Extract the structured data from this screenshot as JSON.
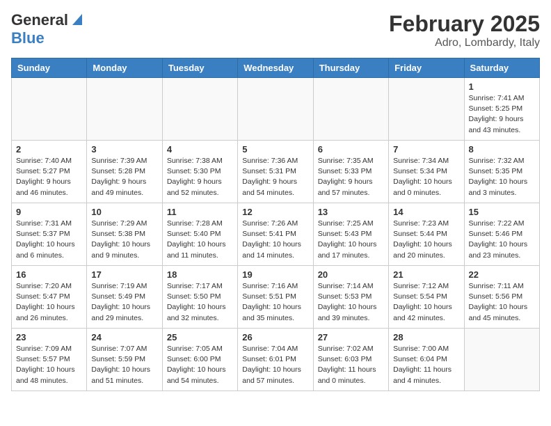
{
  "header": {
    "logo_general": "General",
    "logo_blue": "Blue",
    "title": "February 2025",
    "subtitle": "Adro, Lombardy, Italy"
  },
  "weekdays": [
    "Sunday",
    "Monday",
    "Tuesday",
    "Wednesday",
    "Thursday",
    "Friday",
    "Saturday"
  ],
  "weeks": [
    [
      {
        "day": "",
        "detail": ""
      },
      {
        "day": "",
        "detail": ""
      },
      {
        "day": "",
        "detail": ""
      },
      {
        "day": "",
        "detail": ""
      },
      {
        "day": "",
        "detail": ""
      },
      {
        "day": "",
        "detail": ""
      },
      {
        "day": "1",
        "detail": "Sunrise: 7:41 AM\nSunset: 5:25 PM\nDaylight: 9 hours\nand 43 minutes."
      }
    ],
    [
      {
        "day": "2",
        "detail": "Sunrise: 7:40 AM\nSunset: 5:27 PM\nDaylight: 9 hours\nand 46 minutes."
      },
      {
        "day": "3",
        "detail": "Sunrise: 7:39 AM\nSunset: 5:28 PM\nDaylight: 9 hours\nand 49 minutes."
      },
      {
        "day": "4",
        "detail": "Sunrise: 7:38 AM\nSunset: 5:30 PM\nDaylight: 9 hours\nand 52 minutes."
      },
      {
        "day": "5",
        "detail": "Sunrise: 7:36 AM\nSunset: 5:31 PM\nDaylight: 9 hours\nand 54 minutes."
      },
      {
        "day": "6",
        "detail": "Sunrise: 7:35 AM\nSunset: 5:33 PM\nDaylight: 9 hours\nand 57 minutes."
      },
      {
        "day": "7",
        "detail": "Sunrise: 7:34 AM\nSunset: 5:34 PM\nDaylight: 10 hours\nand 0 minutes."
      },
      {
        "day": "8",
        "detail": "Sunrise: 7:32 AM\nSunset: 5:35 PM\nDaylight: 10 hours\nand 3 minutes."
      }
    ],
    [
      {
        "day": "9",
        "detail": "Sunrise: 7:31 AM\nSunset: 5:37 PM\nDaylight: 10 hours\nand 6 minutes."
      },
      {
        "day": "10",
        "detail": "Sunrise: 7:29 AM\nSunset: 5:38 PM\nDaylight: 10 hours\nand 9 minutes."
      },
      {
        "day": "11",
        "detail": "Sunrise: 7:28 AM\nSunset: 5:40 PM\nDaylight: 10 hours\nand 11 minutes."
      },
      {
        "day": "12",
        "detail": "Sunrise: 7:26 AM\nSunset: 5:41 PM\nDaylight: 10 hours\nand 14 minutes."
      },
      {
        "day": "13",
        "detail": "Sunrise: 7:25 AM\nSunset: 5:43 PM\nDaylight: 10 hours\nand 17 minutes."
      },
      {
        "day": "14",
        "detail": "Sunrise: 7:23 AM\nSunset: 5:44 PM\nDaylight: 10 hours\nand 20 minutes."
      },
      {
        "day": "15",
        "detail": "Sunrise: 7:22 AM\nSunset: 5:46 PM\nDaylight: 10 hours\nand 23 minutes."
      }
    ],
    [
      {
        "day": "16",
        "detail": "Sunrise: 7:20 AM\nSunset: 5:47 PM\nDaylight: 10 hours\nand 26 minutes."
      },
      {
        "day": "17",
        "detail": "Sunrise: 7:19 AM\nSunset: 5:49 PM\nDaylight: 10 hours\nand 29 minutes."
      },
      {
        "day": "18",
        "detail": "Sunrise: 7:17 AM\nSunset: 5:50 PM\nDaylight: 10 hours\nand 32 minutes."
      },
      {
        "day": "19",
        "detail": "Sunrise: 7:16 AM\nSunset: 5:51 PM\nDaylight: 10 hours\nand 35 minutes."
      },
      {
        "day": "20",
        "detail": "Sunrise: 7:14 AM\nSunset: 5:53 PM\nDaylight: 10 hours\nand 39 minutes."
      },
      {
        "day": "21",
        "detail": "Sunrise: 7:12 AM\nSunset: 5:54 PM\nDaylight: 10 hours\nand 42 minutes."
      },
      {
        "day": "22",
        "detail": "Sunrise: 7:11 AM\nSunset: 5:56 PM\nDaylight: 10 hours\nand 45 minutes."
      }
    ],
    [
      {
        "day": "23",
        "detail": "Sunrise: 7:09 AM\nSunset: 5:57 PM\nDaylight: 10 hours\nand 48 minutes."
      },
      {
        "day": "24",
        "detail": "Sunrise: 7:07 AM\nSunset: 5:59 PM\nDaylight: 10 hours\nand 51 minutes."
      },
      {
        "day": "25",
        "detail": "Sunrise: 7:05 AM\nSunset: 6:00 PM\nDaylight: 10 hours\nand 54 minutes."
      },
      {
        "day": "26",
        "detail": "Sunrise: 7:04 AM\nSunset: 6:01 PM\nDaylight: 10 hours\nand 57 minutes."
      },
      {
        "day": "27",
        "detail": "Sunrise: 7:02 AM\nSunset: 6:03 PM\nDaylight: 11 hours\nand 0 minutes."
      },
      {
        "day": "28",
        "detail": "Sunrise: 7:00 AM\nSunset: 6:04 PM\nDaylight: 11 hours\nand 4 minutes."
      },
      {
        "day": "",
        "detail": ""
      }
    ]
  ]
}
